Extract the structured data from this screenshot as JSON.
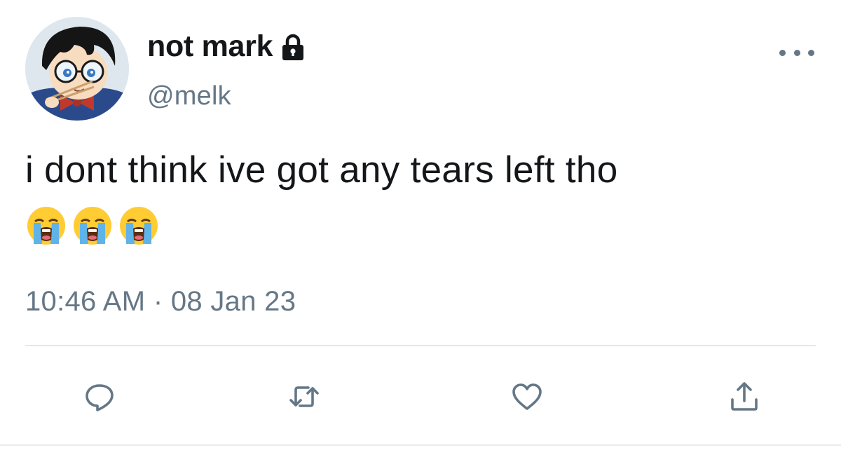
{
  "tweet": {
    "author": {
      "display_name": "not mark",
      "handle": "@melk",
      "protected_icon": "lock-icon",
      "avatar_icon": "avatar-anime-boy-with-glasses"
    },
    "text": "i dont think ive got any tears left tho",
    "emojis": [
      "loudly-crying-face",
      "loudly-crying-face",
      "loudly-crying-face"
    ],
    "timestamp": "10:46 AM · 08 Jan 23",
    "more_icon": "more-horizontal-icon",
    "actions": [
      {
        "name": "reply",
        "icon": "reply-icon"
      },
      {
        "name": "retweet",
        "icon": "retweet-icon"
      },
      {
        "name": "like",
        "icon": "heart-icon"
      },
      {
        "name": "share",
        "icon": "share-icon"
      }
    ]
  },
  "colors": {
    "text_primary": "#14171a",
    "text_secondary": "#657786",
    "divider": "#e1e8ed",
    "background": "#ffffff"
  }
}
